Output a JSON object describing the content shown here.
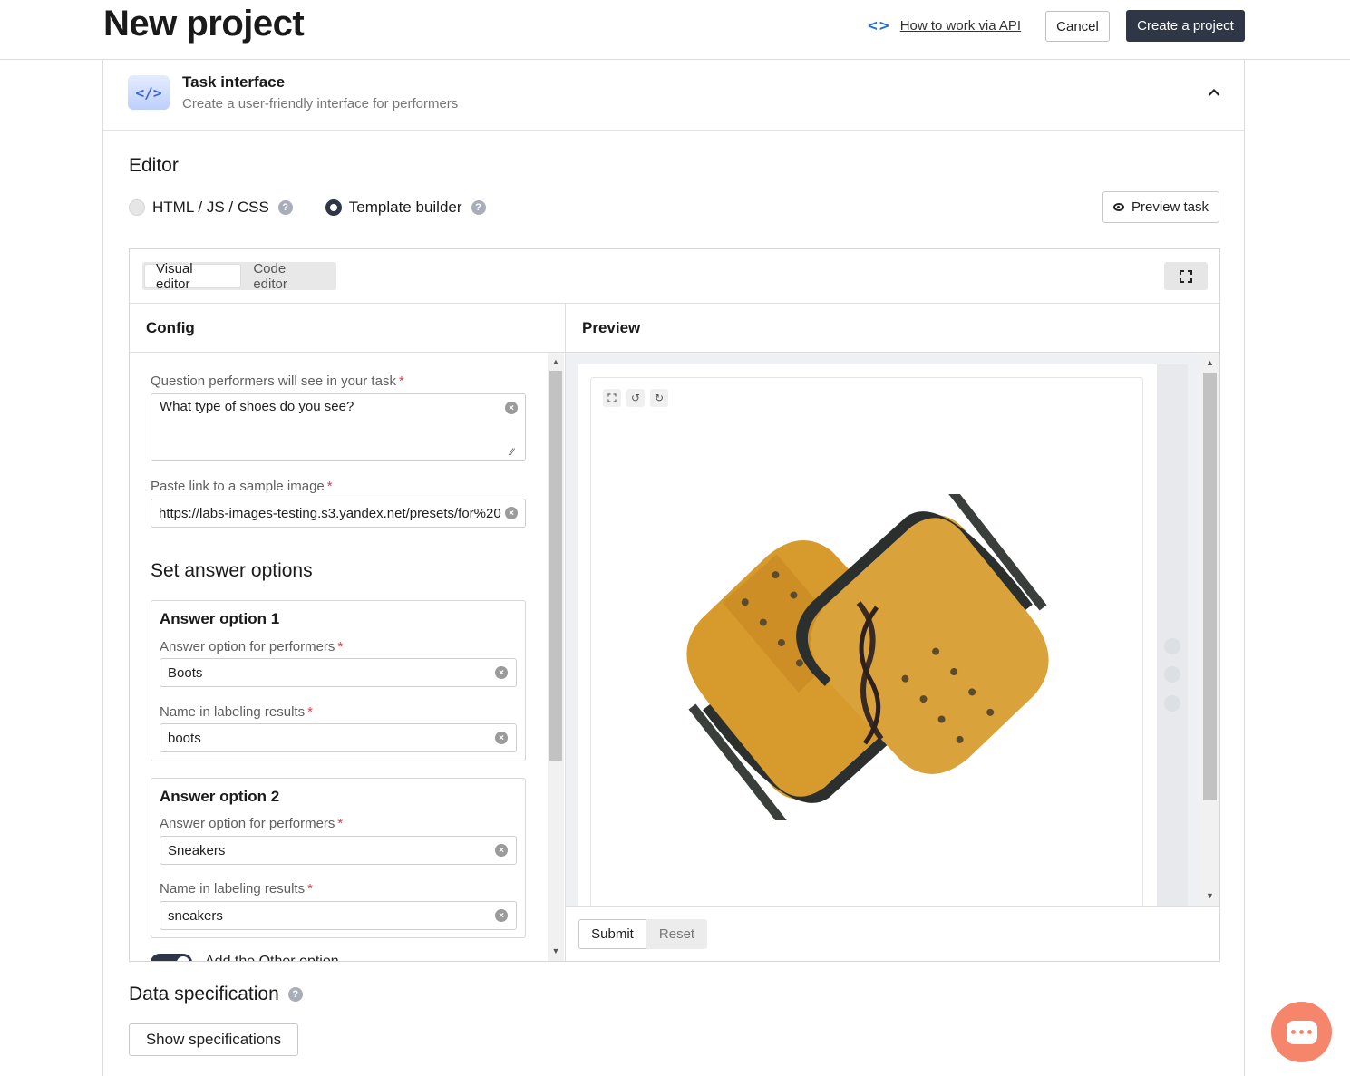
{
  "header": {
    "title": "New project",
    "api_link": "How to work via API",
    "cancel": "Cancel",
    "create": "Create a project"
  },
  "task_interface": {
    "title": "Task interface",
    "subtitle": "Create a user-friendly interface for performers"
  },
  "editor": {
    "label": "Editor",
    "mode_html": "HTML / JS / CSS",
    "mode_template": "Template builder",
    "selected_mode": "Template builder",
    "preview_task": "Preview task",
    "tabs": [
      {
        "label": "Visual editor",
        "active": true
      },
      {
        "label": "Code editor",
        "active": false
      }
    ]
  },
  "config": {
    "heading": "Config",
    "question_label": "Question performers will see in your task",
    "question_value": "What type of shoes do you see?",
    "image_label": "Paste link to a sample image",
    "image_value": "https://labs-images-testing.s3.yandex.net/presets/for%20",
    "answers_heading": "Set answer options",
    "options": [
      {
        "title": "Answer option 1",
        "performer_label": "Answer option for performers",
        "performer_value": "Boots",
        "name_label": "Name in labeling results",
        "name_value": "boots"
      },
      {
        "title": "Answer option 2",
        "performer_label": "Answer option for performers",
        "performer_value": "Sneakers",
        "name_label": "Name in labeling results",
        "name_value": "sneakers"
      }
    ],
    "toggle_label": "Add the Other option"
  },
  "preview": {
    "heading": "Preview",
    "submit": "Submit",
    "reset": "Reset"
  },
  "data_spec": {
    "title": "Data specification",
    "show_button": "Show specifications"
  },
  "colors": {
    "primary_button": "#2f3747",
    "link_icon": "#1e6fd9",
    "chat_fab": "#f6866b",
    "required": "#e23c3c"
  }
}
